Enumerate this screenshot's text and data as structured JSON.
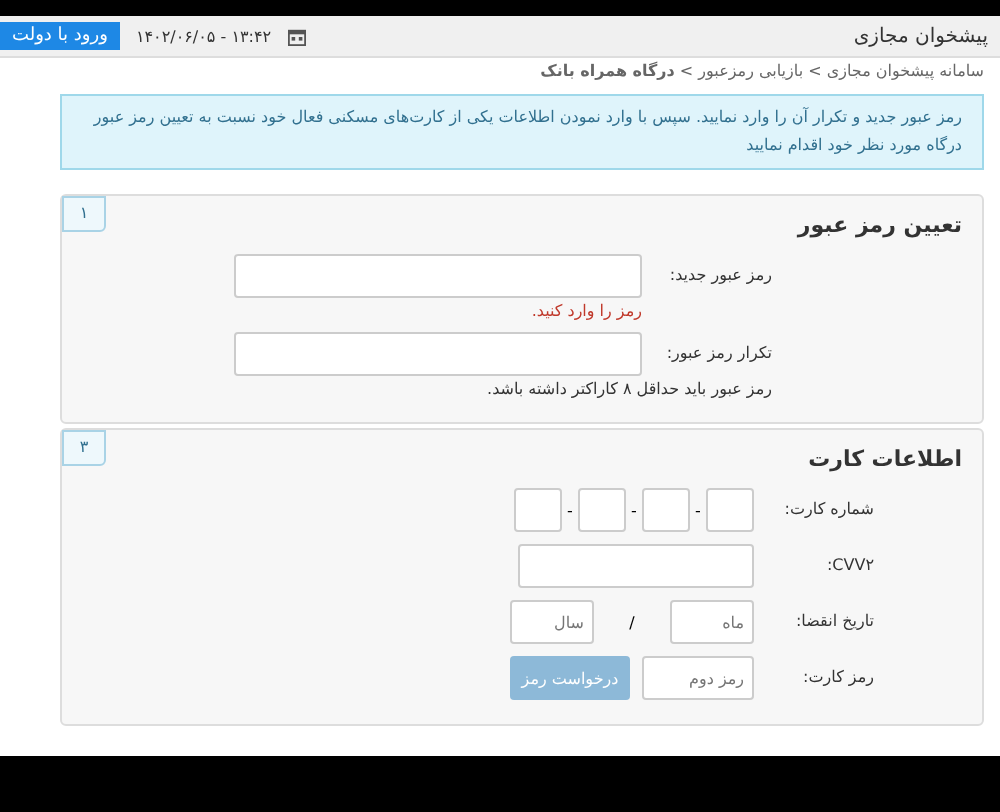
{
  "header": {
    "title": "پیشخوان مجازی",
    "datetime": "۱۴۰۲/۰۶/۰۵ - ۱۳:۴۲",
    "login_button": "ورود با دولت"
  },
  "breadcrumb": "سامانه پیشخوان مجازی > بازیابی رمزعبور > **درگاه همراه بانک**",
  "alert": "رمز عبور جدید و تکرار آن را وارد نمایید. سپس با وارد نمودن اطلاعات یکی از کارت‌های مسکنی فعال خود نسبت به تعیین رمز عبور درگاه مورد نظر خود اقدام نمایید",
  "sections": [
    {
      "badge": "۱",
      "title": "تعیین رمز عبور",
      "fields": [
        {
          "kind": "text",
          "label": "رمز عبور جدید:",
          "error": "رمز را وارد کنید."
        },
        {
          "kind": "text",
          "label": "تکرار رمز عبور:",
          "hint": "رمز عبور باید حداقل ۸ کاراکتر داشته باشد."
        }
      ]
    },
    {
      "badge": "۳",
      "title": "اطلاعات کارت",
      "fields": [
        {
          "kind": "card_number",
          "label": "شماره کارت:",
          "separators": [
            "-",
            "-",
            "-"
          ]
        },
        {
          "kind": "short",
          "label": "CVV۲:"
        },
        {
          "kind": "expiry",
          "label": "تاریخ انقضا:",
          "month_placeholder": "ماه",
          "separator": "/",
          "year_placeholder": "سال"
        },
        {
          "kind": "pin",
          "label": "رمز کارت:",
          "placeholder": "رمز دوم",
          "button": {
            "label": "درخواست رمز",
            "disabled": true
          }
        }
      ]
    }
  ]
}
